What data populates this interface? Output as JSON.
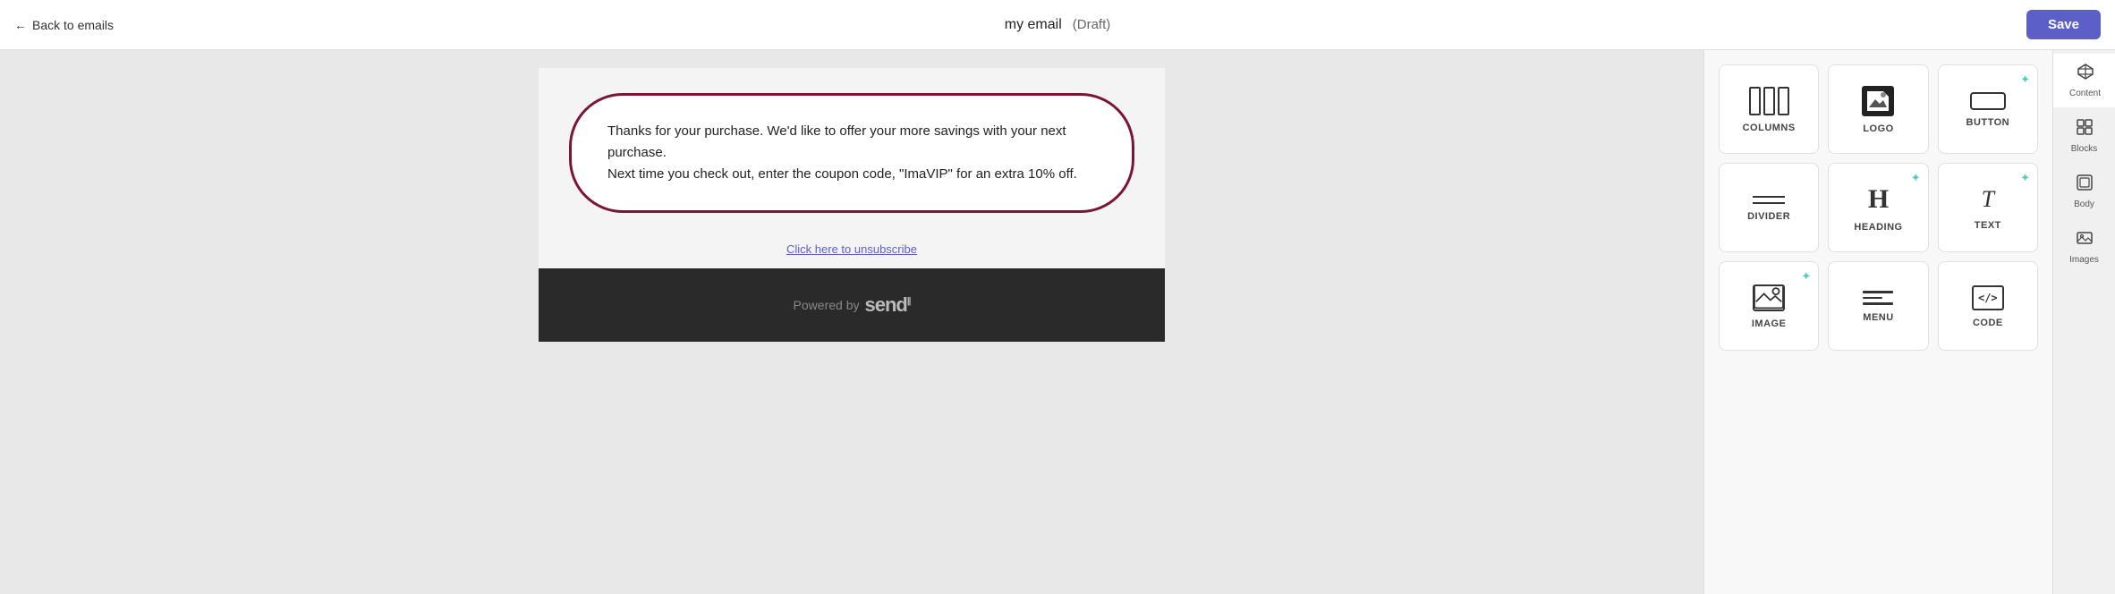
{
  "header": {
    "back_label": "Back to emails",
    "email_name": "my email",
    "draft_label": "(Draft)",
    "save_label": "Save"
  },
  "canvas": {
    "email_text_line1": "Thanks for your purchase. We'd like to offer your more savings with your next purchase.",
    "email_text_line2": "Next time you check out, enter the coupon code, \"ImaVIP\" for an extra 10% off.",
    "unsubscribe_text": "Click here to unsubscribe",
    "footer_powered_by": "Powered by",
    "footer_brand": "send"
  },
  "content_panel": {
    "items": [
      {
        "id": "columns",
        "label": "COLUMNS",
        "has_sparkle": false
      },
      {
        "id": "logo",
        "label": "LOGO",
        "has_sparkle": false
      },
      {
        "id": "button",
        "label": "BUTTON",
        "has_sparkle": true
      },
      {
        "id": "divider",
        "label": "DIVIDER",
        "has_sparkle": false
      },
      {
        "id": "heading",
        "label": "HEADING",
        "has_sparkle": true
      },
      {
        "id": "text",
        "label": "TEXT",
        "has_sparkle": true
      },
      {
        "id": "image",
        "label": "IMAGE",
        "has_sparkle": true
      },
      {
        "id": "menu",
        "label": "MENU",
        "has_sparkle": false
      },
      {
        "id": "code",
        "label": "CODE",
        "has_sparkle": false
      }
    ]
  },
  "sidebar_tabs": [
    {
      "id": "content",
      "label": "Content",
      "active": true
    },
    {
      "id": "blocks",
      "label": "Blocks",
      "active": false
    },
    {
      "id": "body",
      "label": "Body",
      "active": false
    },
    {
      "id": "images",
      "label": "Images",
      "active": false
    }
  ]
}
